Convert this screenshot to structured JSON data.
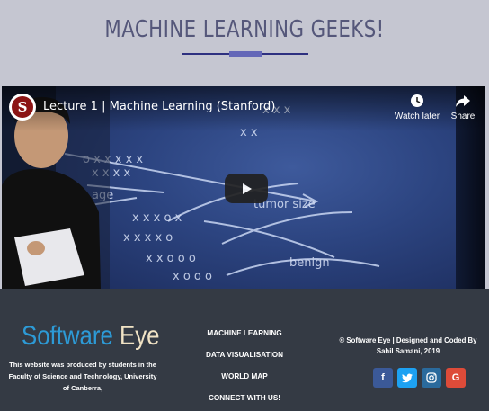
{
  "header": {
    "title": "MACHINE LEARNING GEEKS!",
    "colors": {
      "background": "#c5c6d1",
      "title": "#55577a",
      "underline": "#2e3080",
      "underline_accent": "#6467b8"
    }
  },
  "video": {
    "channel_icon": "stanford-logo-icon",
    "channel_letter": "S",
    "title": "Lecture 1 | Machine Learning (Stanford)",
    "watch_later_label": "Watch later",
    "share_label": "Share",
    "icons": {
      "watch_later": "clock-icon",
      "share": "share-arrow-icon",
      "play": "play-icon"
    }
  },
  "footer": {
    "brand_part1": "Software",
    "brand_part2": "Eye",
    "about_text": "This website was produced by students in the Faculty of Science and Technology, University of Canberra,",
    "nav": [
      {
        "label": "MACHINE LEARNING"
      },
      {
        "label": "DATA VISUALISATION"
      },
      {
        "label": "WORLD MAP"
      },
      {
        "label": "CONNECT WITH US!"
      }
    ],
    "credit_text": "© Software Eye | Designed and Coded By Sahil Samani, 2019",
    "social": [
      {
        "icon": "facebook-icon",
        "glyph": "f",
        "color": "#3b5998"
      },
      {
        "icon": "twitter-icon",
        "glyph": "t",
        "color": "#1da1f2"
      },
      {
        "icon": "instagram-icon",
        "glyph": "◎",
        "color": "#2a6a9c"
      },
      {
        "icon": "google-icon",
        "glyph": "G",
        "color": "#dd4b39"
      }
    ],
    "colors": {
      "background": "#343a44",
      "brand_blue": "#2d9ad6",
      "brand_cream": "#f1e3c5"
    }
  }
}
